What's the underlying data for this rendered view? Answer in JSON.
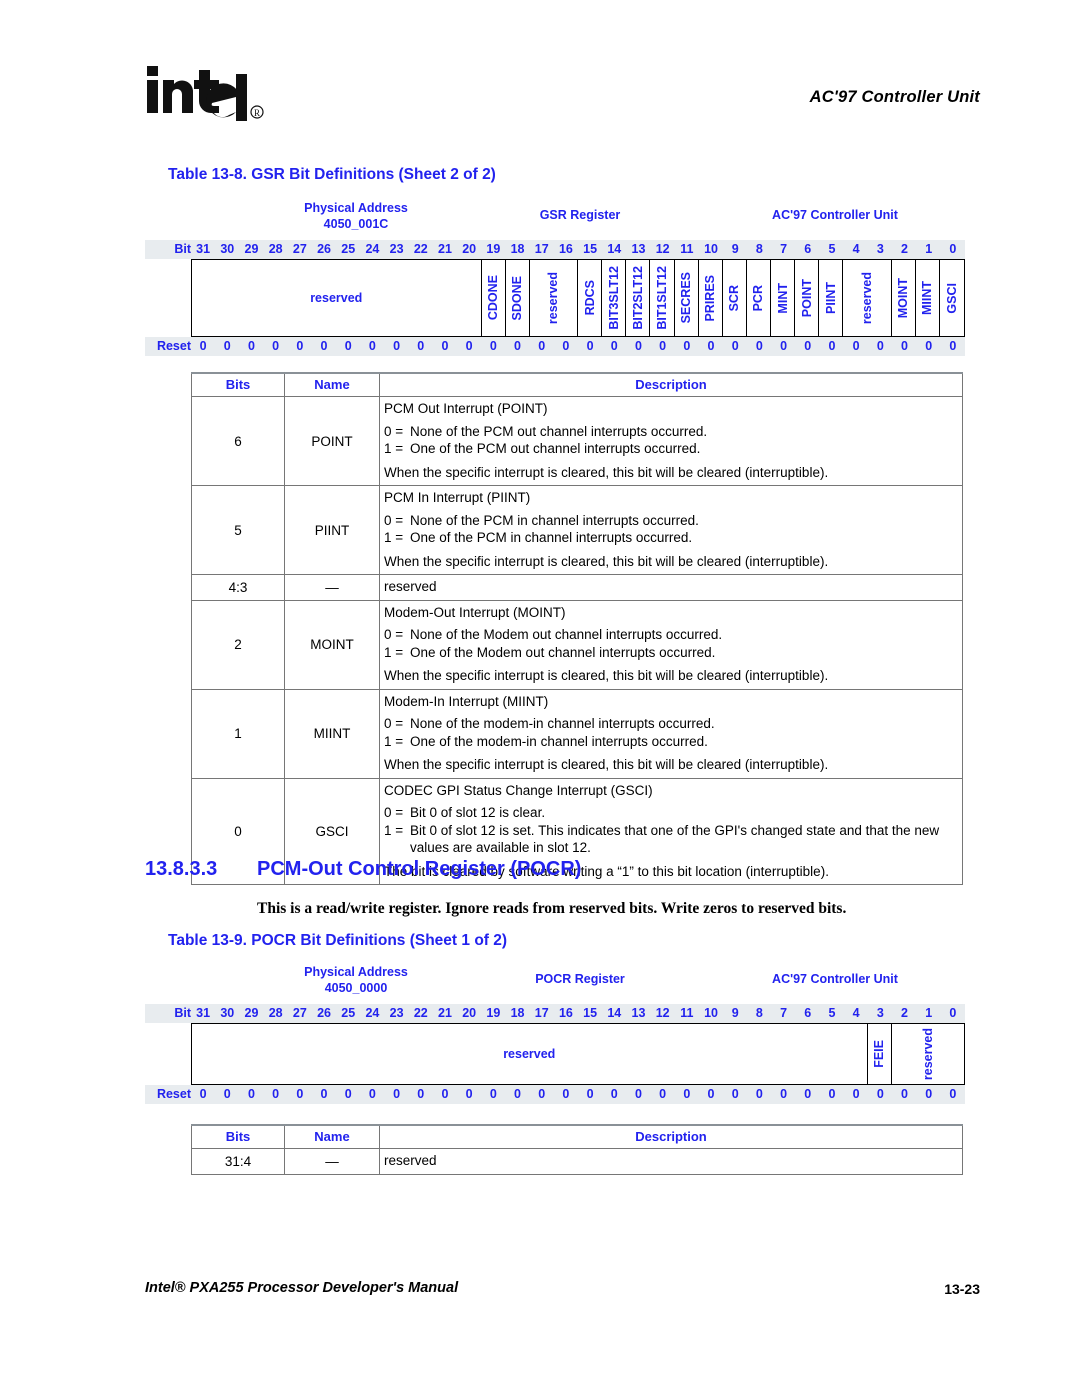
{
  "header": {
    "logo_alt": "intel",
    "logo_mark": "®",
    "chapter_title": "AC'97 Controller Unit"
  },
  "footer": {
    "manual_title": "Intel® PXA255 Processor Developer's Manual",
    "page_number": "13-23"
  },
  "gsr_table": {
    "caption": "Table 13-8. GSR Bit Definitions (Sheet 2 of 2)",
    "diagram": {
      "physical_address_label": "Physical Address",
      "physical_address_value": "4050_001C",
      "register_name": "GSR Register",
      "unit_name": "AC'97 Controller Unit",
      "bit_row_label": "Bit",
      "reset_row_label": "Reset",
      "bit_numbers": [
        "31",
        "30",
        "29",
        "28",
        "27",
        "26",
        "25",
        "24",
        "23",
        "22",
        "21",
        "20",
        "19",
        "18",
        "17",
        "16",
        "15",
        "14",
        "13",
        "12",
        "11",
        "10",
        "9",
        "8",
        "7",
        "6",
        "5",
        "4",
        "3",
        "2",
        "1",
        "0"
      ],
      "reset_values": [
        "0",
        "0",
        "0",
        "0",
        "0",
        "0",
        "0",
        "0",
        "0",
        "0",
        "0",
        "0",
        "0",
        "0",
        "0",
        "0",
        "0",
        "0",
        "0",
        "0",
        "0",
        "0",
        "0",
        "0",
        "0",
        "0",
        "0",
        "0",
        "0",
        "0",
        "0",
        "0"
      ],
      "fields": [
        {
          "label": "reserved",
          "bits": 12,
          "orient": "horizontal"
        },
        {
          "label": "CDONE",
          "bits": 1,
          "orient": "vertical"
        },
        {
          "label": "SDONE",
          "bits": 1,
          "orient": "vertical"
        },
        {
          "label": "reserved",
          "bits": 2,
          "orient": "vertical"
        },
        {
          "label": "RDCS",
          "bits": 1,
          "orient": "vertical"
        },
        {
          "label": "BIT3SLT12",
          "bits": 1,
          "orient": "vertical"
        },
        {
          "label": "BIT2SLT12",
          "bits": 1,
          "orient": "vertical"
        },
        {
          "label": "BIT1SLT12",
          "bits": 1,
          "orient": "vertical"
        },
        {
          "label": "SECRES",
          "bits": 1,
          "orient": "vertical"
        },
        {
          "label": "PRIRES",
          "bits": 1,
          "orient": "vertical"
        },
        {
          "label": "SCR",
          "bits": 1,
          "orient": "vertical"
        },
        {
          "label": "PCR",
          "bits": 1,
          "orient": "vertical"
        },
        {
          "label": "MINT",
          "bits": 1,
          "orient": "vertical"
        },
        {
          "label": "POINT",
          "bits": 1,
          "orient": "vertical"
        },
        {
          "label": "PIINT",
          "bits": 1,
          "orient": "vertical"
        },
        {
          "label": "reserved",
          "bits": 2,
          "orient": "vertical"
        },
        {
          "label": "MOINT",
          "bits": 1,
          "orient": "vertical"
        },
        {
          "label": "MIINT",
          "bits": 1,
          "orient": "vertical"
        },
        {
          "label": "GSCI",
          "bits": 1,
          "orient": "vertical"
        }
      ]
    },
    "columns": [
      "Bits",
      "Name",
      "Description"
    ],
    "rows": [
      {
        "bits": "6",
        "name": "POINT",
        "title": "PCM Out Interrupt (POINT)",
        "enum": [
          {
            "key": "0 =",
            "value": "None of the PCM out channel interrupts occurred."
          },
          {
            "key": "1 =",
            "value": "One of the PCM out channel interrupts occurred."
          }
        ],
        "note": "When the specific interrupt is cleared, this bit will be cleared (interruptible)."
      },
      {
        "bits": "5",
        "name": "PIINT",
        "title": "PCM In Interrupt (PIINT)",
        "enum": [
          {
            "key": "0 =",
            "value": "None of the PCM in channel interrupts occurred."
          },
          {
            "key": "1 =",
            "value": "One of the PCM in channel interrupts occurred."
          }
        ],
        "note": "When the specific interrupt is cleared, this bit will be cleared (interruptible)."
      },
      {
        "bits": "4:3",
        "name": "—",
        "plain": "reserved"
      },
      {
        "bits": "2",
        "name": "MOINT",
        "title": "Modem-Out Interrupt (MOINT)",
        "enum": [
          {
            "key": "0 =",
            "value": "None of the Modem out channel interrupts occurred."
          },
          {
            "key": "1 =",
            "value": "One of the Modem out channel interrupts occurred."
          }
        ],
        "note": "When the specific interrupt is cleared, this bit will be cleared (interruptible)."
      },
      {
        "bits": "1",
        "name": "MIINT",
        "title": "Modem-In Interrupt (MIINT)",
        "enum": [
          {
            "key": "0 =",
            "value": "None of the modem-in channel interrupts occurred."
          },
          {
            "key": "1 =",
            "value": "One of the modem-in channel interrupts occurred."
          }
        ],
        "note": "When the specific interrupt is cleared, this bit will be cleared (interruptible)."
      },
      {
        "bits": "0",
        "name": "GSCI",
        "title": "CODEC GPI Status Change Interrupt (GSCI)",
        "enum": [
          {
            "key": "0 =",
            "value": "Bit 0 of slot 12 is clear."
          },
          {
            "key": "1 =",
            "value": "Bit 0 of slot 12 is set. This indicates that one of the GPI's changed state and that the new values are available in slot 12."
          }
        ],
        "note": "The bit is cleared by software writing a “1” to this bit location (interruptible)."
      }
    ]
  },
  "pocr_section": {
    "number": "13.8.3.3",
    "title": "PCM-Out Control Register (POCR)",
    "paragraph": "This is a read/write register. Ignore reads from reserved bits. Write zeros to reserved bits."
  },
  "pocr_table": {
    "caption": "Table 13-9. POCR Bit Definitions (Sheet 1 of 2)",
    "diagram": {
      "physical_address_label": "Physical Address",
      "physical_address_value": "4050_0000",
      "register_name": "POCR Register",
      "unit_name": "AC'97 Controller Unit",
      "bit_row_label": "Bit",
      "reset_row_label": "Reset",
      "bit_numbers": [
        "31",
        "30",
        "29",
        "28",
        "27",
        "26",
        "25",
        "24",
        "23",
        "22",
        "21",
        "20",
        "19",
        "18",
        "17",
        "16",
        "15",
        "14",
        "13",
        "12",
        "11",
        "10",
        "9",
        "8",
        "7",
        "6",
        "5",
        "4",
        "3",
        "2",
        "1",
        "0"
      ],
      "reset_values": [
        "0",
        "0",
        "0",
        "0",
        "0",
        "0",
        "0",
        "0",
        "0",
        "0",
        "0",
        "0",
        "0",
        "0",
        "0",
        "0",
        "0",
        "0",
        "0",
        "0",
        "0",
        "0",
        "0",
        "0",
        "0",
        "0",
        "0",
        "0",
        "0",
        "0",
        "0",
        "0"
      ],
      "fields": [
        {
          "label": "reserved",
          "bits": 28,
          "orient": "horizontal"
        },
        {
          "label": "FEIE",
          "bits": 1,
          "orient": "vertical"
        },
        {
          "label": "reserved",
          "bits": 3,
          "orient": "vertical"
        }
      ]
    },
    "columns": [
      "Bits",
      "Name",
      "Description"
    ],
    "rows": [
      {
        "bits": "31:4",
        "name": "—",
        "plain": "reserved"
      }
    ]
  }
}
